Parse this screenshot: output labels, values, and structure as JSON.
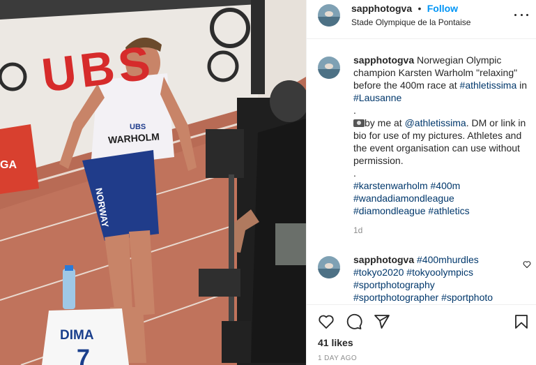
{
  "post": {
    "username": "sapphotogva",
    "follow_label": "Follow",
    "location": "Stade Olympique de la Pontaise"
  },
  "photo": {
    "sponsor_ubs": "UBS",
    "sponsor_dga": "GA",
    "bib_brand": "UBS",
    "bib_name": "WARHOLM",
    "shorts_text": "NORWAY",
    "block_brand": "DIMA",
    "block_lane": "7"
  },
  "caption": {
    "username": "sapphotogva",
    "text_1": "Norwegian Olympic champion Karsten Warholm \"relaxing\" before the 400m race at ",
    "tag_athletissima": "#athletissima",
    "text_in": " in ",
    "tag_lausanne": "#Lausanne",
    "dot": ".",
    "by_me": "by me at ",
    "mention": "@athletissima",
    "text_2": ". DM or link in bio for use of my pictures. Athletes and the event organisation can use without permission.",
    "dot2": ".",
    "tags": [
      "#karstenwarholm",
      "#400m",
      "#wandadiamondleague",
      "#diamondleague",
      "#athletics"
    ],
    "time": "1d",
    "camera_icon": "camera-icon"
  },
  "comment": {
    "username": "sapphotogva",
    "tags": [
      "#400mhurdles",
      "#tokyo2020",
      "#tokyoolympics",
      "#sportphotography",
      "#sportphotographer",
      "#sportphoto"
    ]
  },
  "actions": {
    "likes": "41 likes",
    "ago": "1 DAY AGO"
  },
  "colors": {
    "accent": "#0095f6",
    "hashtag": "#00376b",
    "muted": "#8e8e8e"
  }
}
